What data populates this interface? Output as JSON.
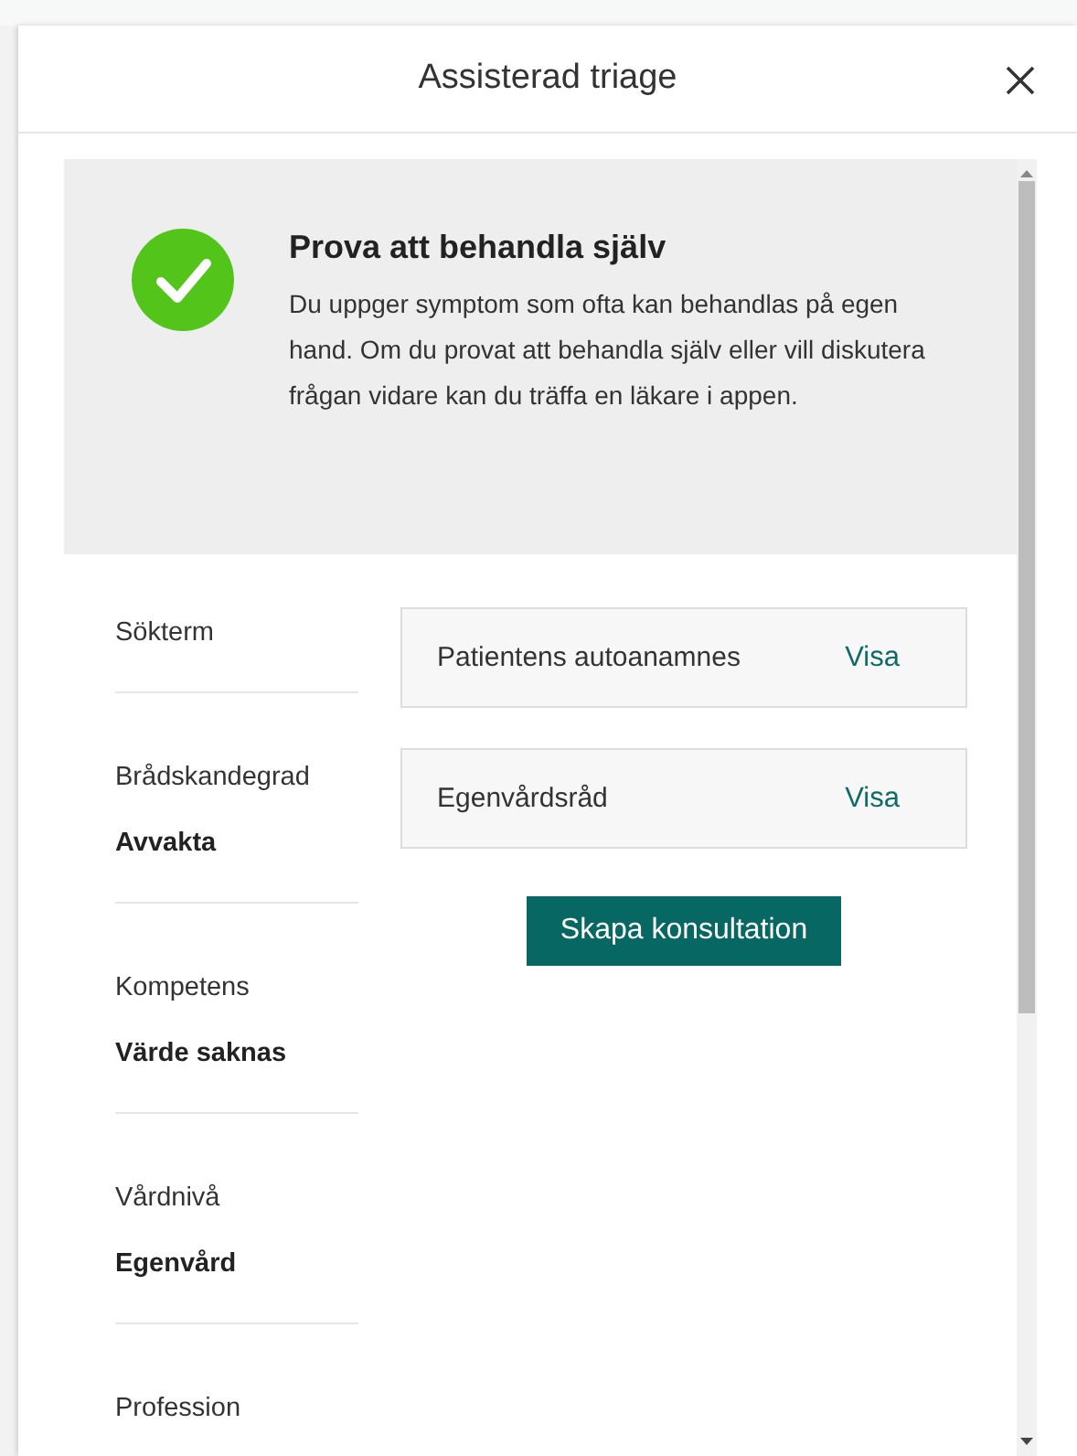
{
  "dialog": {
    "title": "Assisterad triage"
  },
  "result": {
    "kind": "success",
    "title": "Prova att behandla själv",
    "text": "Du uppger symptom som ofta kan behandlas på egen hand. Om du provat att behandla själv eller vill diskutera frågan vidare kan du träffa en läkare i appen."
  },
  "fields": [
    {
      "label": "Sökterm"
    },
    {
      "label": "Brådskandegrad",
      "value": "Avvakta"
    },
    {
      "label": "Kompetens",
      "value": "Värde saknas"
    },
    {
      "label": "Vårdnivå",
      "value": "Egenvård"
    },
    {
      "label": "Profession"
    }
  ],
  "cards": [
    {
      "label": "Patientens autoanamnes",
      "link": "Visa"
    },
    {
      "label": "Egenvårdsråd",
      "link": "Visa"
    }
  ],
  "primary_button": "Skapa konsultation"
}
